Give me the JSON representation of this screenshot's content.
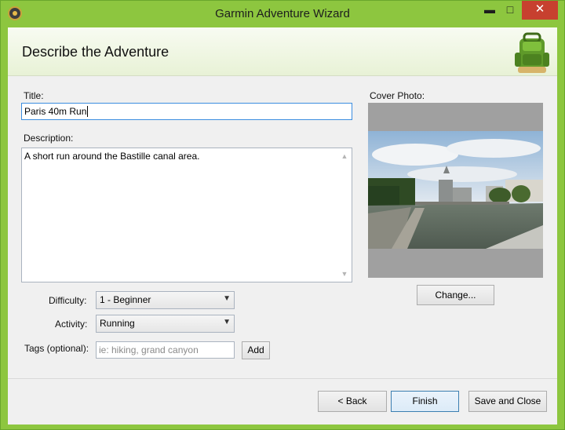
{
  "window": {
    "title": "Garmin Adventure Wizard",
    "controls": {
      "minimize": "▬",
      "maximize": "□",
      "close": "✕"
    }
  },
  "header": {
    "title": "Describe the Adventure"
  },
  "form": {
    "title_label": "Title:",
    "title_value": "Paris 40m Run",
    "description_label": "Description:",
    "description_value": "A short run around the Bastille canal area.",
    "difficulty_label": "Difficulty:",
    "difficulty_value": "1 - Beginner",
    "activity_label": "Activity:",
    "activity_value": "Running",
    "tags_label": "Tags (optional):",
    "tags_placeholder": "ie: hiking, grand canyon",
    "add_label": "Add"
  },
  "cover": {
    "label": "Cover Photo:",
    "change_label": "Change..."
  },
  "footer": {
    "back_label": "< Back",
    "finish_label": "Finish",
    "save_close_label": "Save and Close"
  },
  "icons": {
    "scroll_up": "▲",
    "scroll_down": "▼",
    "dropdown": "▼"
  },
  "colors": {
    "frame": "#8dc63f",
    "close": "#c7402f",
    "focus": "#3b8ee0"
  }
}
